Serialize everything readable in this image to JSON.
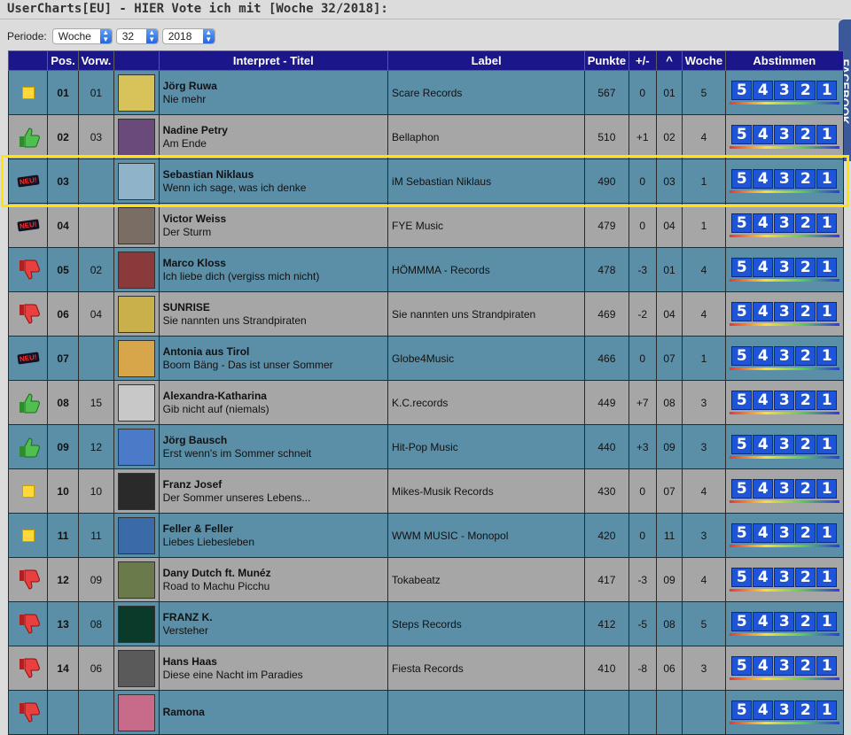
{
  "page": {
    "heading": "UserCharts[EU] - HIER Vote ich mit [Woche 32/2018]:",
    "period_label": "Periode:",
    "period_type": "Woche",
    "week": "32",
    "year": "2018",
    "sidebar_tab": "FACEBOOK"
  },
  "columns": [
    "Pos.",
    "Vorw.",
    "Interpret - Titel",
    "Label",
    "Punkte",
    "+/-",
    "^",
    "Woche",
    "Abstimmen"
  ],
  "vote_buttons": [
    "5",
    "4",
    "3",
    "2",
    "1"
  ],
  "trend_icons": {
    "same": "yellow-square",
    "up": "thumbs-up",
    "down": "thumbs-down",
    "new": "neu-badge"
  },
  "new_badge_text": "NEU!",
  "colors": {
    "header": "#1b178a",
    "row_a": "#5b8fa8",
    "row_b": "#a6a6a6",
    "highlight": "#ffe500",
    "vote_button": "#1e55d8"
  },
  "rows": [
    {
      "trend": "same",
      "pos": "01",
      "prev": "01",
      "artist": "Jörg Ruwa",
      "title": "Nie mehr",
      "label": "Scare Records",
      "points": "567",
      "diff": "0",
      "peak": "01",
      "weeks": "5",
      "style": "a",
      "cover": "#d7c35a"
    },
    {
      "trend": "up",
      "pos": "02",
      "prev": "03",
      "artist": "Nadine Petry",
      "title": "Am Ende",
      "label": "Bellaphon",
      "points": "510",
      "diff": "+1",
      "peak": "02",
      "weeks": "4",
      "style": "b",
      "cover": "#6a4a7a"
    },
    {
      "trend": "new",
      "pos": "03",
      "prev": "",
      "artist": "Sebastian Niklaus",
      "title": "Wenn ich sage, was ich denke",
      "label": "iM Sebastian Niklaus",
      "points": "490",
      "diff": "0",
      "peak": "03",
      "weeks": "1",
      "style": "a",
      "cover": "#8fb3c8",
      "highlight": true
    },
    {
      "trend": "new",
      "pos": "04",
      "prev": "",
      "artist": "Victor Weiss",
      "title": "Der Sturm",
      "label": "FYE Music",
      "points": "479",
      "diff": "0",
      "peak": "04",
      "weeks": "1",
      "style": "b",
      "cover": "#7a6e64"
    },
    {
      "trend": "down",
      "pos": "05",
      "prev": "02",
      "artist": "Marco Kloss",
      "title": "Ich liebe dich (vergiss mich nicht)",
      "label": "HÖMMMA - Records",
      "points": "478",
      "diff": "-3",
      "peak": "01",
      "weeks": "4",
      "style": "a",
      "cover": "#8a3a3a"
    },
    {
      "trend": "down",
      "pos": "06",
      "prev": "04",
      "artist": "SUNRISE",
      "title": "Sie nannten uns Strandpiraten",
      "label": "Sie nannten uns Strandpiraten",
      "points": "469",
      "diff": "-2",
      "peak": "04",
      "weeks": "4",
      "style": "b",
      "cover": "#c9b04a"
    },
    {
      "trend": "new",
      "pos": "07",
      "prev": "",
      "artist": "Antonia aus Tirol",
      "title": "Boom Bäng - Das ist unser Sommer",
      "label": "Globe4Music",
      "points": "466",
      "diff": "0",
      "peak": "07",
      "weeks": "1",
      "style": "a",
      "cover": "#d8a64a"
    },
    {
      "trend": "up",
      "pos": "08",
      "prev": "15",
      "artist": "Alexandra-Katharina",
      "title": "Gib nicht auf (niemals)",
      "label": "K.C.records",
      "points": "449",
      "diff": "+7",
      "peak": "08",
      "weeks": "3",
      "style": "b",
      "cover": "#c8c8c8"
    },
    {
      "trend": "up",
      "pos": "09",
      "prev": "12",
      "artist": "Jörg Bausch",
      "title": "Erst wenn's im Sommer schneit",
      "label": "Hit-Pop Music",
      "points": "440",
      "diff": "+3",
      "peak": "09",
      "weeks": "3",
      "style": "a",
      "cover": "#4a7ac8"
    },
    {
      "trend": "same",
      "pos": "10",
      "prev": "10",
      "artist": "Franz Josef",
      "title": "Der Sommer unseres Lebens...",
      "label": "Mikes-Musik Records",
      "points": "430",
      "diff": "0",
      "peak": "07",
      "weeks": "4",
      "style": "b",
      "cover": "#2a2a2a"
    },
    {
      "trend": "same",
      "pos": "11",
      "prev": "11",
      "artist": "Feller & Feller",
      "title": "Liebes Liebesleben",
      "label": "WWM MUSIC - Monopol",
      "points": "420",
      "diff": "0",
      "peak": "11",
      "weeks": "3",
      "style": "a",
      "cover": "#3a6aa8"
    },
    {
      "trend": "down",
      "pos": "12",
      "prev": "09",
      "artist": "Dany Dutch ft. Munéz",
      "title": "Road to Machu Picchu",
      "label": "Tokabeatz",
      "points": "417",
      "diff": "-3",
      "peak": "09",
      "weeks": "4",
      "style": "b",
      "cover": "#6a7a4a"
    },
    {
      "trend": "down",
      "pos": "13",
      "prev": "08",
      "artist": "FRANZ K.",
      "title": "Versteher",
      "label": "Steps Records",
      "points": "412",
      "diff": "-5",
      "peak": "08",
      "weeks": "5",
      "style": "a",
      "cover": "#0a3a2a"
    },
    {
      "trend": "down",
      "pos": "14",
      "prev": "06",
      "artist": "Hans Haas",
      "title": "Diese eine Nacht im Paradies",
      "label": "Fiesta Records",
      "points": "410",
      "diff": "-8",
      "peak": "06",
      "weeks": "3",
      "style": "b",
      "cover": "#5a5a5a"
    },
    {
      "trend": "down",
      "pos": "",
      "prev": "",
      "artist": "Ramona",
      "title": "",
      "label": "",
      "points": "",
      "diff": "",
      "peak": "",
      "weeks": "",
      "style": "a",
      "cover": "#c86a8a"
    }
  ]
}
